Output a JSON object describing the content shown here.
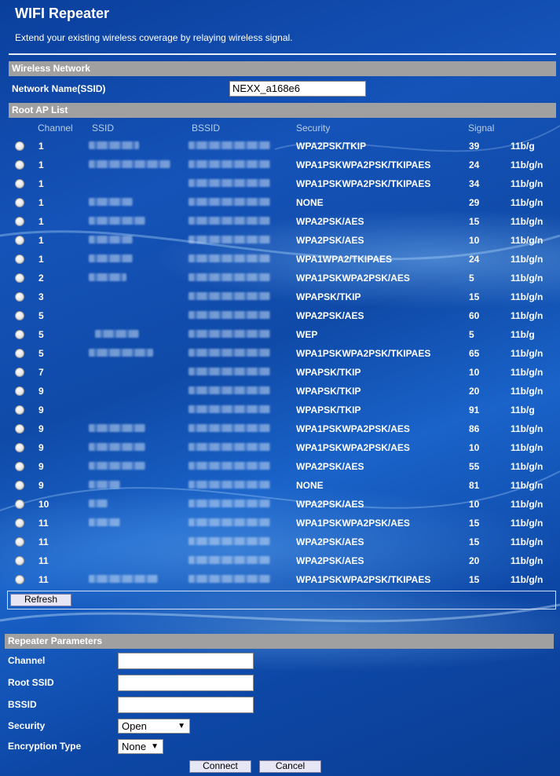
{
  "header": {
    "title": "WIFI Repeater",
    "subtitle": "Extend your existing wireless coverage by relaying wireless signal."
  },
  "wireless_network": {
    "section_title": "Wireless Network",
    "ssid_label": "Network Name(SSID)",
    "ssid_value": "NEXX_a168e6"
  },
  "root_ap_list": {
    "section_title": "Root AP List",
    "columns": {
      "channel": "Channel",
      "ssid": "SSID",
      "bssid": "BSSID",
      "security": "Security",
      "signal": "Signal"
    },
    "rows": [
      {
        "channel": "1",
        "security": "WPA2PSK/TKIP",
        "signal": "39",
        "mode": "11b/g"
      },
      {
        "channel": "1",
        "security": "WPA1PSKWPA2PSK/TKIPAES",
        "signal": "24",
        "mode": "11b/g/n"
      },
      {
        "channel": "1",
        "security": "WPA1PSKWPA2PSK/TKIPAES",
        "signal": "34",
        "mode": "11b/g/n"
      },
      {
        "channel": "1",
        "security": "NONE",
        "signal": "29",
        "mode": "11b/g/n"
      },
      {
        "channel": "1",
        "security": "WPA2PSK/AES",
        "signal": "15",
        "mode": "11b/g/n"
      },
      {
        "channel": "1",
        "security": "WPA2PSK/AES",
        "signal": "10",
        "mode": "11b/g/n"
      },
      {
        "channel": "1",
        "security": "WPA1WPA2/TKIPAES",
        "signal": "24",
        "mode": "11b/g/n"
      },
      {
        "channel": "2",
        "security": "WPA1PSKWPA2PSK/AES",
        "signal": "5",
        "mode": "11b/g/n"
      },
      {
        "channel": "3",
        "security": "WPAPSK/TKIP",
        "signal": "15",
        "mode": "11b/g/n"
      },
      {
        "channel": "5",
        "security": "WPA2PSK/AES",
        "signal": "60",
        "mode": "11b/g/n"
      },
      {
        "channel": "5",
        "security": "WEP",
        "signal": "5",
        "mode": "11b/g"
      },
      {
        "channel": "5",
        "security": "WPA1PSKWPA2PSK/TKIPAES",
        "signal": "65",
        "mode": "11b/g/n"
      },
      {
        "channel": "7",
        "security": "WPAPSK/TKIP",
        "signal": "10",
        "mode": "11b/g/n"
      },
      {
        "channel": "9",
        "security": "WPAPSK/TKIP",
        "signal": "20",
        "mode": "11b/g/n"
      },
      {
        "channel": "9",
        "security": "WPAPSK/TKIP",
        "signal": "91",
        "mode": "11b/g"
      },
      {
        "channel": "9",
        "security": "WPA1PSKWPA2PSK/AES",
        "signal": "86",
        "mode": "11b/g/n"
      },
      {
        "channel": "9",
        "security": "WPA1PSKWPA2PSK/AES",
        "signal": "10",
        "mode": "11b/g/n"
      },
      {
        "channel": "9",
        "security": "WPA2PSK/AES",
        "signal": "55",
        "mode": "11b/g/n"
      },
      {
        "channel": "9",
        "security": "NONE",
        "signal": "81",
        "mode": "11b/g/n"
      },
      {
        "channel": "10",
        "security": "WPA2PSK/AES",
        "signal": "10",
        "mode": "11b/g/n"
      },
      {
        "channel": "11",
        "security": "WPA1PSKWPA2PSK/AES",
        "signal": "15",
        "mode": "11b/g/n"
      },
      {
        "channel": "11",
        "security": "WPA2PSK/AES",
        "signal": "15",
        "mode": "11b/g/n"
      },
      {
        "channel": "11",
        "security": "WPA2PSK/AES",
        "signal": "20",
        "mode": "11b/g/n"
      },
      {
        "channel": "11",
        "security": "WPA1PSKWPA2PSK/TKIPAES",
        "signal": "15",
        "mode": "11b/g/n"
      }
    ],
    "refresh_label": "Refresh"
  },
  "repeater_parameters": {
    "section_title": "Repeater Parameters",
    "channel_label": "Channel",
    "channel_value": "",
    "root_ssid_label": "Root SSID",
    "root_ssid_value": "",
    "bssid_label": "BSSID",
    "bssid_value": "",
    "security_label": "Security",
    "security_selected": "Open",
    "encryption_label": "Encryption Type",
    "encryption_selected": "None",
    "connect_label": "Connect",
    "cancel_label": "Cancel"
  },
  "icons": {
    "radio": "radio-button-icon",
    "dropdown": "dropdown-arrow-icon"
  }
}
